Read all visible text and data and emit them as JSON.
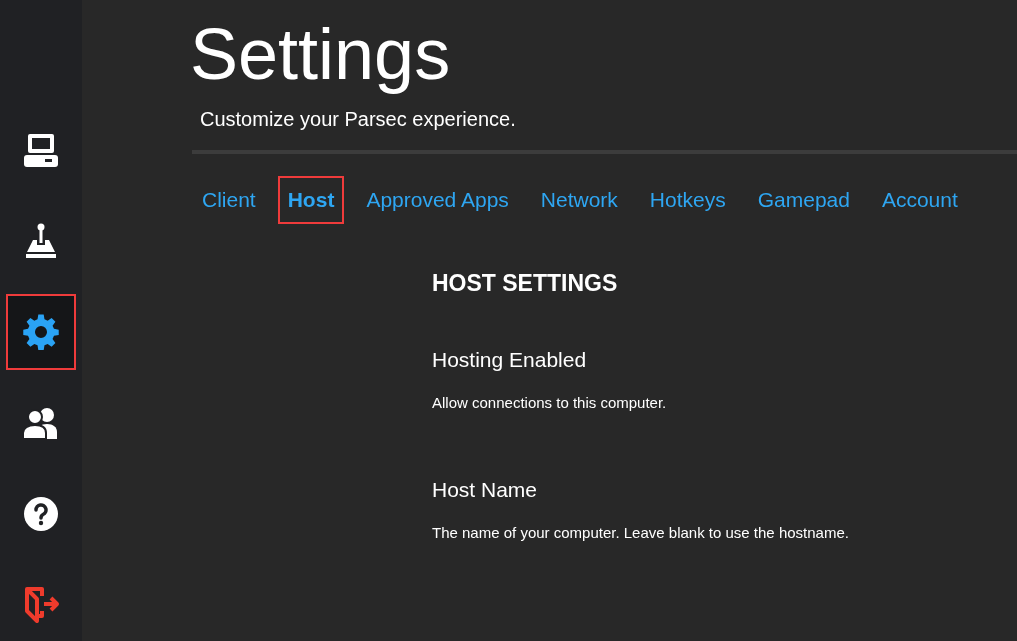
{
  "sidebar": {
    "items": [
      {
        "kind": "computer",
        "selected": false,
        "highlighted": false
      },
      {
        "kind": "joystick",
        "selected": false,
        "highlighted": false
      },
      {
        "kind": "gear",
        "selected": true,
        "highlighted": true
      },
      {
        "kind": "people",
        "selected": false,
        "highlighted": false
      },
      {
        "kind": "help",
        "selected": false,
        "highlighted": false
      },
      {
        "kind": "logout",
        "selected": false,
        "highlighted": false
      }
    ]
  },
  "page": {
    "title": "Settings",
    "subtitle": "Customize your Parsec experience."
  },
  "tabs": [
    {
      "label": "Client",
      "selected": false,
      "highlighted": false
    },
    {
      "label": "Host",
      "selected": true,
      "highlighted": true
    },
    {
      "label": "Approved Apps",
      "selected": false,
      "highlighted": false
    },
    {
      "label": "Network",
      "selected": false,
      "highlighted": false
    },
    {
      "label": "Hotkeys",
      "selected": false,
      "highlighted": false
    },
    {
      "label": "Gamepad",
      "selected": false,
      "highlighted": false
    },
    {
      "label": "Account",
      "selected": false,
      "highlighted": false
    }
  ],
  "section": {
    "heading": "HOST SETTINGS",
    "settings": [
      {
        "label": "Hosting Enabled",
        "description": "Allow connections to this computer."
      },
      {
        "label": "Host Name",
        "description": "The name of your computer. Leave blank to use the hostname."
      }
    ]
  }
}
